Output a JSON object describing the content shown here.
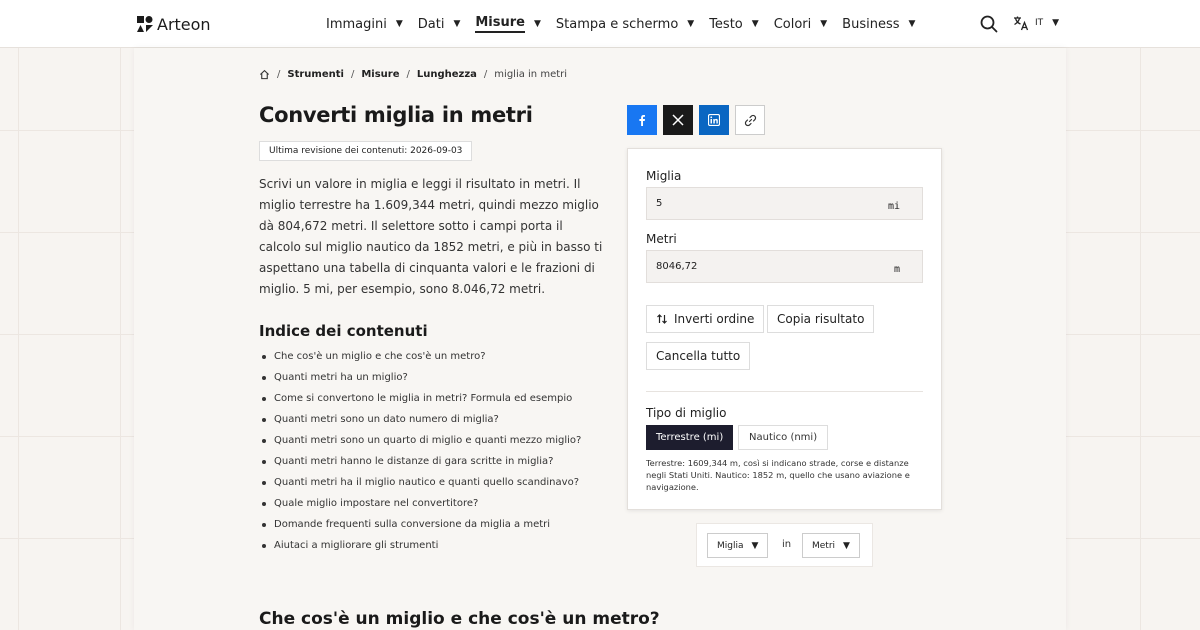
{
  "header": {
    "brand": "Arteon",
    "nav": [
      {
        "label": "Immagini",
        "active": false
      },
      {
        "label": "Dati",
        "active": false
      },
      {
        "label": "Misure",
        "active": true
      },
      {
        "label": "Stampa e schermo",
        "active": false
      },
      {
        "label": "Testo",
        "active": false
      },
      {
        "label": "Colori",
        "active": false
      },
      {
        "label": "Business",
        "active": false
      }
    ],
    "language": "IT",
    "icons": {
      "search": "search-icon",
      "language": "translate-icon",
      "home": "home-icon"
    }
  },
  "breadcrumb": {
    "items": [
      "Strumenti",
      "Misure",
      "Lunghezza"
    ],
    "current": "miglia in metri"
  },
  "article": {
    "title": "Converti miglia in metri",
    "revision": "Ultima revisione dei contenuti: 2026-09-03",
    "intro": "Scrivi un valore in miglia e leggi il risultato in metri. Il miglio terrestre ha 1.609,344 metri, quindi mezzo miglio dà 804,672 metri. Il selettore sotto i campi porta il calcolo sul miglio nautico da 1852 metri, e più in basso ti aspettano una tabella di cinquanta valori e le frazioni di miglio. 5 mi, per esempio, sono 8.046,72 metri.",
    "toc_title": "Indice dei contenuti",
    "toc": [
      "Che cos'è un miglio e che cos'è un metro?",
      "Quanti metri ha un miglio?",
      "Come si convertono le miglia in metri? Formula ed esempio",
      "Quanti metri sono un dato numero di miglia?",
      "Quanti metri sono un quarto di miglio e quanti mezzo miglio?",
      "Quanti metri hanno le distanze di gara scritte in miglia?",
      "Quanti metri ha il miglio nautico e quanti quello scandinavo?",
      "Quale miglio impostare nel convertitore?",
      "Domande frequenti sulla conversione da miglia a metri",
      "Aiutaci a migliorare gli strumenti"
    ],
    "section_title": "Che cos'è un miglio e che cos'è un metro?"
  },
  "share": {
    "icons": [
      "facebook-icon",
      "x-icon",
      "linkedin-icon",
      "link-icon"
    ]
  },
  "converter": {
    "from_label": "Miglia",
    "from_value": "5",
    "from_unit": "mi",
    "to_label": "Metri",
    "to_value": "8046,72",
    "to_unit": "m",
    "swap_label": "Inverti ordine",
    "copy_label": "Copia risultato",
    "clear_label": "Cancella tutto",
    "mode_label": "Tipo di miglio",
    "mode_options": [
      "Terrestre (mi)",
      "Nautico (nmi)"
    ],
    "mode_selected": "Terrestre (mi)",
    "mode_note": "Terrestre: 1609,344 m, così si indicano strade, corse e distanze negli Stati Uniti. Nautico: 1852 m, quello che usano aviazione e navigazione."
  },
  "unit_picker": {
    "from": "Miglia",
    "connector": "in",
    "to": "Metri"
  },
  "colors": {
    "accent_dark": "#1d1d2e",
    "facebook": "#1877f2",
    "x": "#1a1a1a",
    "linkedin": "#0a66c2"
  }
}
